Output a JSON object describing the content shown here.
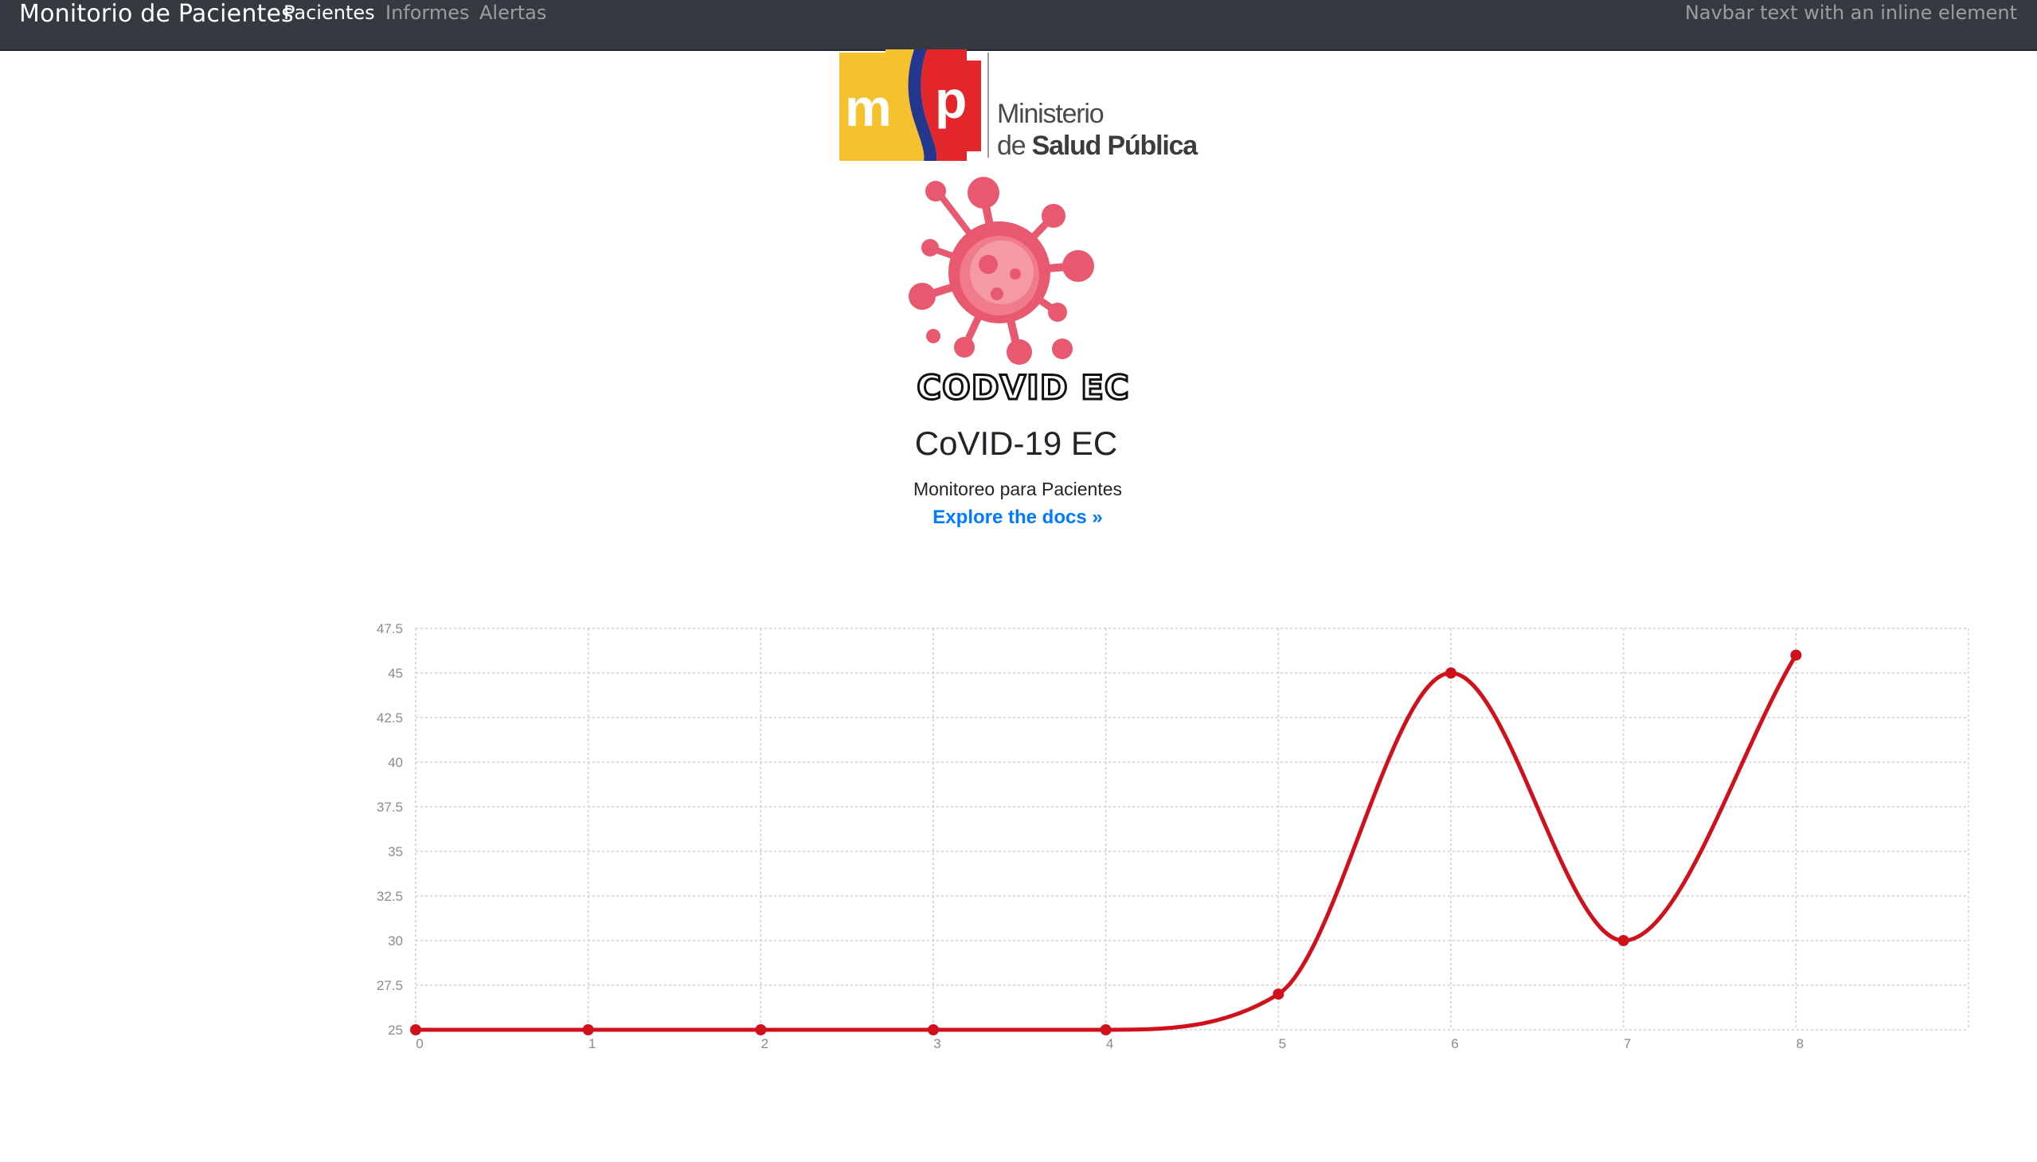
{
  "navbar": {
    "brand": "Monitorio de Pacientes",
    "links": [
      {
        "label": "Pacientes",
        "active": true
      },
      {
        "label": "Informes",
        "active": false
      },
      {
        "label": "Alertas",
        "active": false
      }
    ],
    "text": "Navbar text with an inline element",
    "background": "#343a40"
  },
  "logo": {
    "letters": "msp",
    "ministry_line1": "Ministerio",
    "ministry_line2_prefix": "de",
    "ministry_line2_bold": "Salud Pública",
    "colors": {
      "yellow": "#f5c22e",
      "red": "#e3262a",
      "blue": "#25378d"
    }
  },
  "hero": {
    "icon": "virus-icon",
    "icon_color": "#e8586f",
    "wordmark": "CODVID EC",
    "title": "CoVID-19 EC",
    "subtitle": "Monitoreo para Pacientes",
    "link": "Explore the docs »",
    "link_color": "#007bff"
  },
  "chart_data": {
    "type": "line",
    "title": "",
    "xlabel": "",
    "ylabel": "",
    "x": [
      0,
      1,
      2,
      3,
      4,
      5,
      6,
      7,
      8
    ],
    "series": [
      {
        "values": [
          25,
          25,
          25,
          25,
          25,
          27,
          45,
          30,
          46
        ],
        "color": "#d0111c"
      }
    ],
    "xticks": [
      "0",
      "1",
      "2",
      "3",
      "4",
      "5",
      "6",
      "7",
      "8"
    ],
    "yticks": [
      "25",
      "27.5",
      "30",
      "32.5",
      "35",
      "37.5",
      "40",
      "42.5",
      "45",
      "47.5"
    ],
    "ylim": [
      25,
      47.5
    ],
    "xlim": [
      0,
      9
    ],
    "grid": true,
    "grid_style": "dotted",
    "curve": "smooth"
  }
}
